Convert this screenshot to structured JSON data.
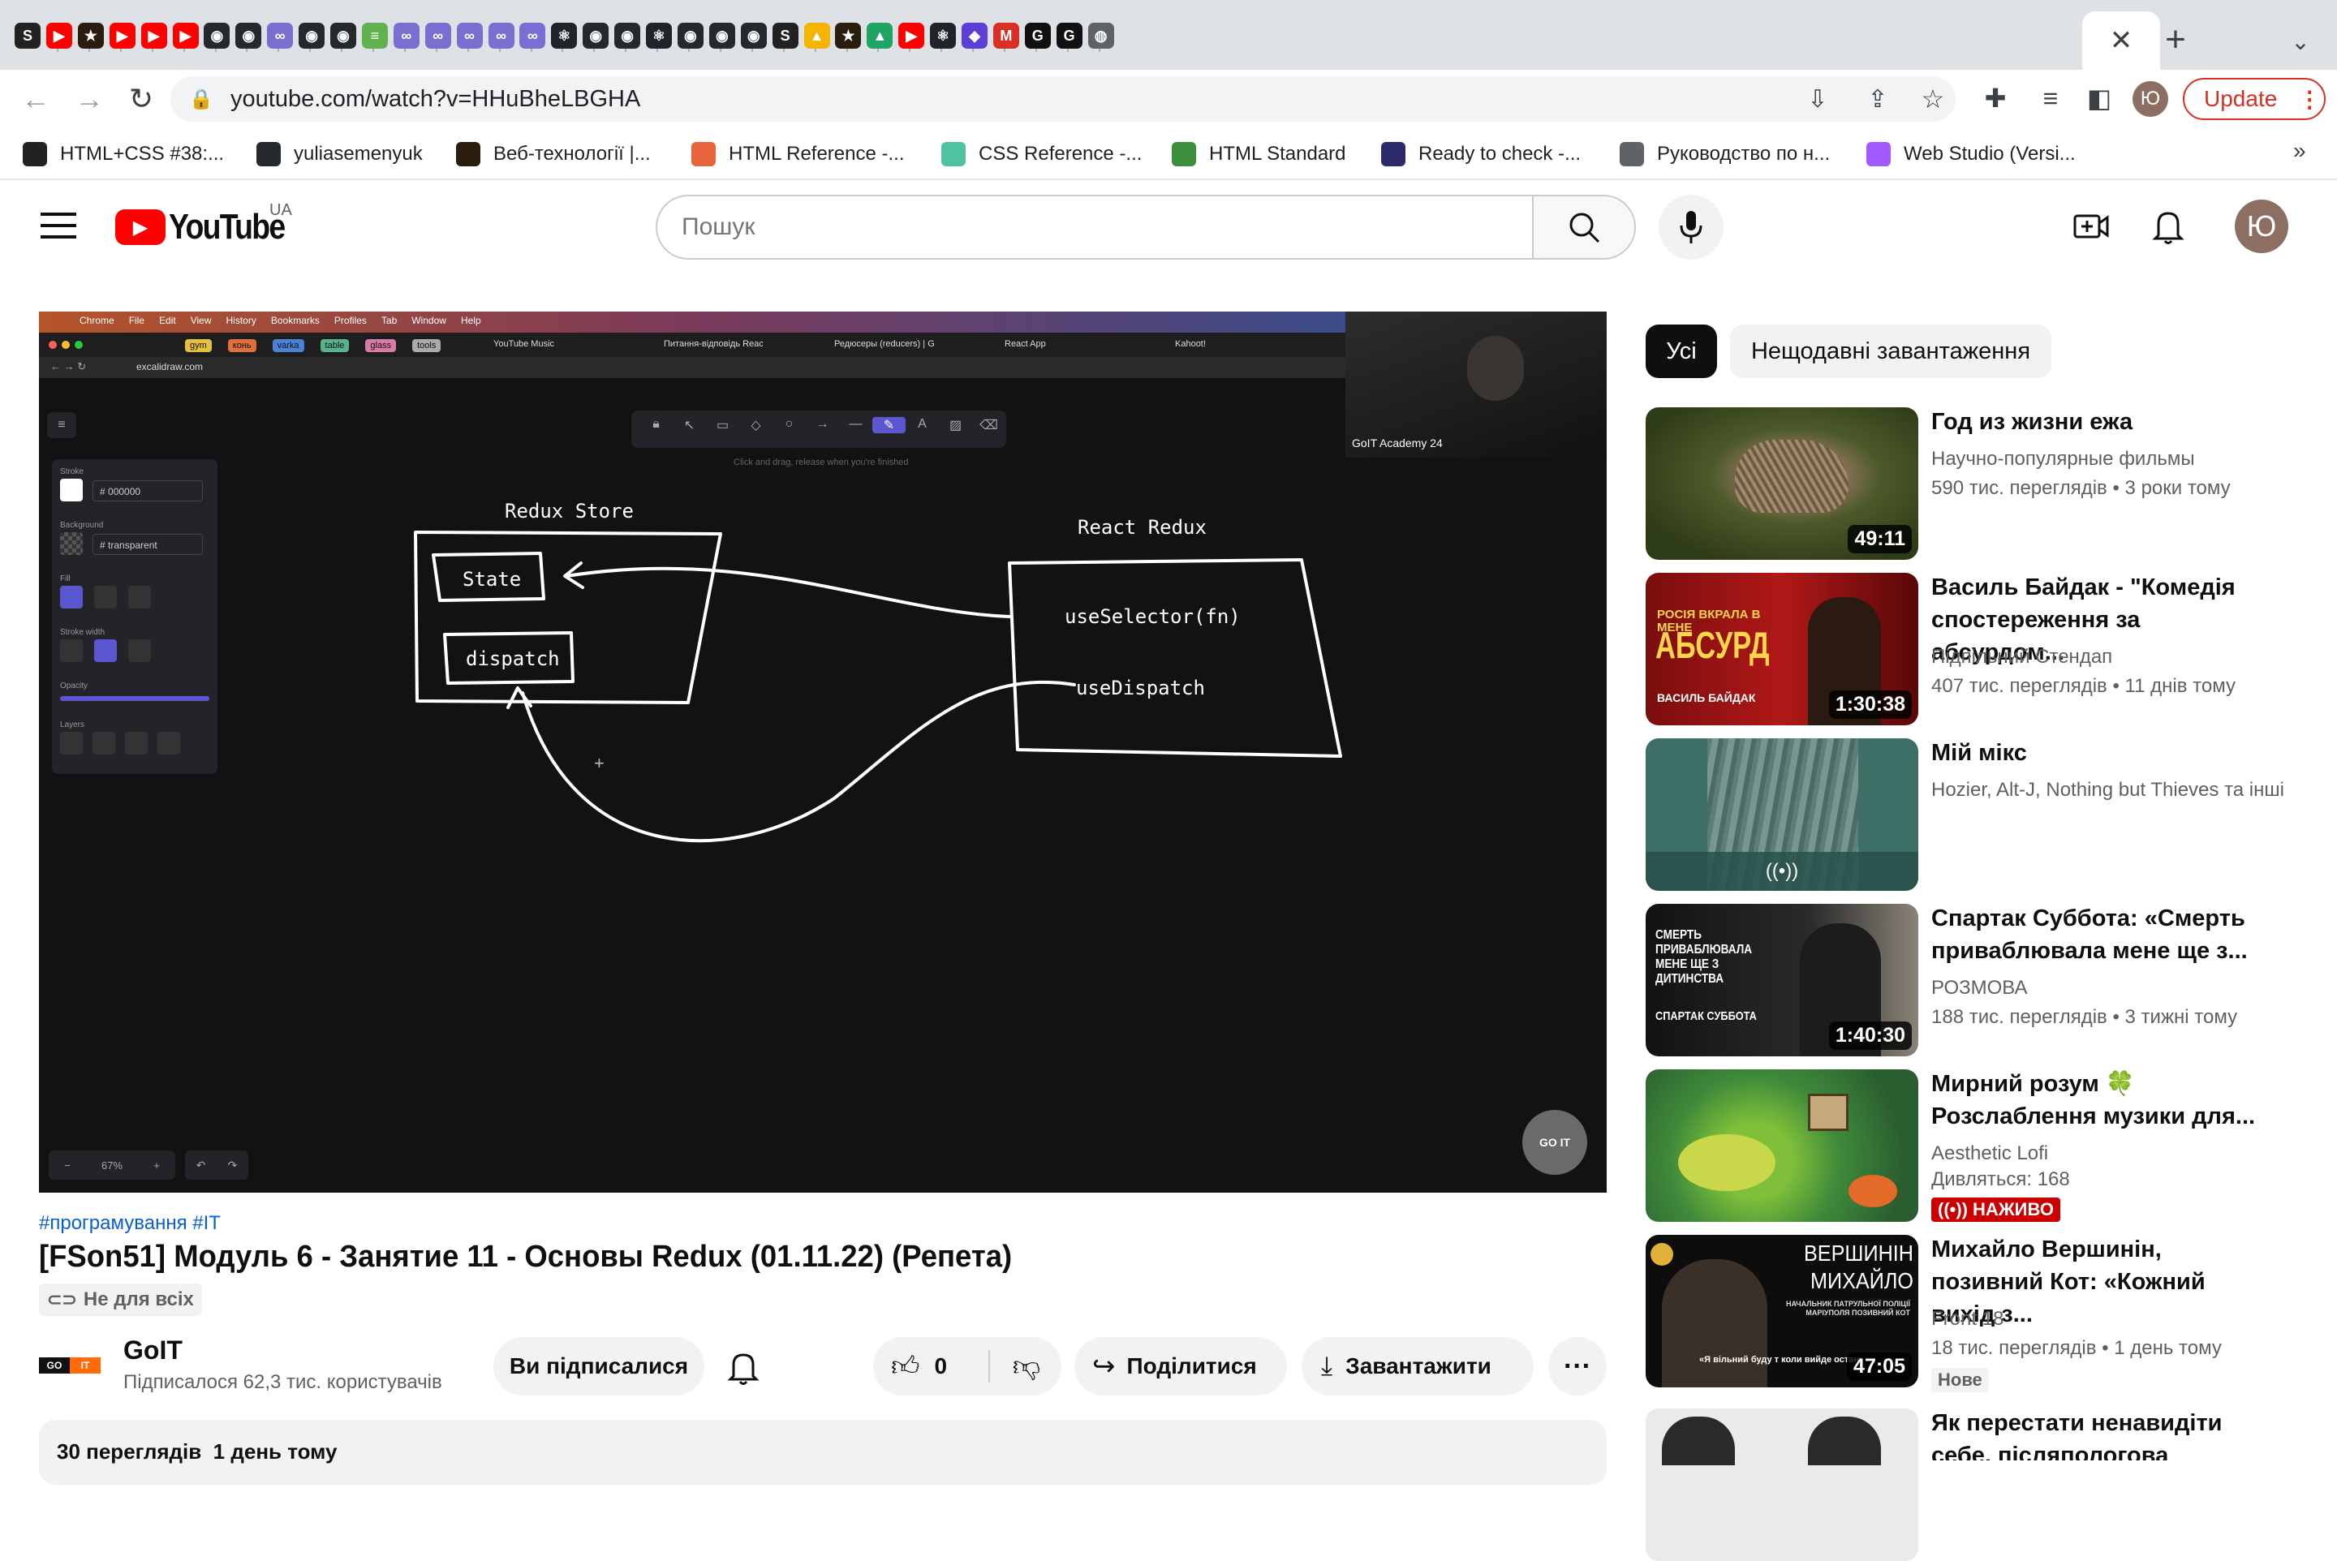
{
  "browser": {
    "tab_favicons": [
      {
        "icon": "s-circle-icon",
        "color": "#222222",
        "glyph": "S"
      },
      {
        "icon": "youtube-icon",
        "color": "#ff0000",
        "glyph": "▶"
      },
      {
        "icon": "star-icon",
        "color": "#2b1d0e",
        "glyph": "★"
      },
      {
        "icon": "youtube-icon",
        "color": "#ff0000",
        "glyph": "▶"
      },
      {
        "icon": "youtube-icon",
        "color": "#ff0000",
        "glyph": "▶"
      },
      {
        "icon": "youtube-icon",
        "color": "#ff0000",
        "glyph": "▶"
      },
      {
        "icon": "github-icon",
        "color": "#24292e",
        "glyph": "◉"
      },
      {
        "icon": "github-icon",
        "color": "#24292e",
        "glyph": "◉"
      },
      {
        "icon": "knot-icon",
        "color": "#7a6fd0",
        "glyph": "∞"
      },
      {
        "icon": "github-icon",
        "color": "#24292e",
        "glyph": "◉"
      },
      {
        "icon": "github-icon",
        "color": "#24292e",
        "glyph": "◉"
      },
      {
        "icon": "notes-icon",
        "color": "#62b24f",
        "glyph": "≡"
      },
      {
        "icon": "knot-icon",
        "color": "#7a6fd0",
        "glyph": "∞"
      },
      {
        "icon": "knot-icon",
        "color": "#7a6fd0",
        "glyph": "∞"
      },
      {
        "icon": "knot-icon",
        "color": "#7a6fd0",
        "glyph": "∞"
      },
      {
        "icon": "knot-icon",
        "color": "#7a6fd0",
        "glyph": "∞"
      },
      {
        "icon": "knot-icon",
        "color": "#7a6fd0",
        "glyph": "∞"
      },
      {
        "icon": "react-icon",
        "color": "#20232a",
        "glyph": "⚛"
      },
      {
        "icon": "github-icon",
        "color": "#24292e",
        "glyph": "◉"
      },
      {
        "icon": "github-icon",
        "color": "#24292e",
        "glyph": "◉"
      },
      {
        "icon": "react-icon",
        "color": "#20232a",
        "glyph": "⚛"
      },
      {
        "icon": "github-icon",
        "color": "#24292e",
        "glyph": "◉"
      },
      {
        "icon": "github-icon",
        "color": "#24292e",
        "glyph": "◉"
      },
      {
        "icon": "github-icon",
        "color": "#24292e",
        "glyph": "◉"
      },
      {
        "icon": "s-circle-icon",
        "color": "#222222",
        "glyph": "S"
      },
      {
        "icon": "drive-icon",
        "color": "#f4b400",
        "glyph": "▲"
      },
      {
        "icon": "star-icon",
        "color": "#2b1d0e",
        "glyph": "★"
      },
      {
        "icon": "drive-icon",
        "color": "#1fa463",
        "glyph": "▲"
      },
      {
        "icon": "youtube-icon",
        "color": "#ff0000",
        "glyph": "▶"
      },
      {
        "icon": "react-icon",
        "color": "#20232a",
        "glyph": "⚛"
      },
      {
        "icon": "prisma-icon",
        "color": "#5b3fd6",
        "glyph": "◆"
      },
      {
        "icon": "gmail-icon",
        "color": "#d93025",
        "glyph": "M"
      },
      {
        "icon": "goit-icon",
        "color": "#111111",
        "glyph": "G"
      },
      {
        "icon": "goit-icon",
        "color": "#111111",
        "glyph": "G"
      },
      {
        "icon": "globe-icon",
        "color": "#5f6368",
        "glyph": "◍"
      }
    ],
    "url": "youtube.com/watch?v=HHuBheLBGHA",
    "update_label": "Update",
    "profile_initial": "Ю",
    "bookmarks": [
      {
        "label": "HTML+CSS #38:...",
        "icon": "s-circle-icon",
        "color": "#222222"
      },
      {
        "label": "yuliasemenyuk",
        "icon": "github-icon",
        "color": "#24292e"
      },
      {
        "label": "Веб-технології |...",
        "icon": "star-icon",
        "color": "#2b1d0e"
      },
      {
        "label": "HTML Reference -...",
        "icon": "codecademy-icon",
        "color": "#e8643c"
      },
      {
        "label": "CSS Reference -...",
        "icon": "triangle-icon",
        "color": "#4fc3a1"
      },
      {
        "label": "HTML Standard",
        "icon": "question-icon",
        "color": "#3c8f3c"
      },
      {
        "label": "Ready to check -...",
        "icon": "logo-icon",
        "color": "#2d2a6b"
      },
      {
        "label": "Руководство по н...",
        "icon": "globe-icon",
        "color": "#5f6368"
      },
      {
        "label": "Web Studio (Versi...",
        "icon": "figma-icon",
        "color": "#a259ff"
      }
    ],
    "more_bookmarks": "»"
  },
  "youtube": {
    "logo_text": "YouTube",
    "region": "UA",
    "search_placeholder": "Пошук",
    "avatar_initial": "Ю",
    "brand_color": "#ff0000"
  },
  "video_frame": {
    "mac_menu": [
      "Chrome",
      "File",
      "Edit",
      "View",
      "History",
      "Bookmarks",
      "Profiles",
      "Tab",
      "Window",
      "Help"
    ],
    "tab_chips": [
      "gym",
      "конь",
      "varka",
      "table",
      "glass",
      "tools"
    ],
    "tabs": [
      "YouTube Music",
      "Питання-відповідь Reac",
      "Редюсеры (reducers) | G",
      "React App",
      "Kahoot!"
    ],
    "url": "excalidraw.com",
    "hint": "Click and drag, release when you're finished",
    "panel": {
      "stroke_label": "Stroke",
      "stroke_value": "000000",
      "background_label": "Background",
      "background_value": "transparent",
      "fill_label": "Fill",
      "stroke_width_label": "Stroke width",
      "opacity_label": "Opacity",
      "layers_label": "Layers"
    },
    "zoom": "67%",
    "webcam_label": "GoIT Academy 24",
    "diagram": {
      "store_title": "Redux Store",
      "state": "State",
      "dispatch": "dispatch",
      "react_title": "React Redux",
      "use_selector": "useSelector(fn)",
      "use_dispatch": "useDispatch"
    },
    "watermark": "GO IT"
  },
  "video": {
    "hashtags": "#програмування #IT",
    "title": "[FSon51] Модуль 6 - Занятие 11 - Основы Redux (01.11.22) (Репета)",
    "restriction": "Не для всіх",
    "channel_name": "GoIT",
    "subscribers": "Підписалося 62,3 тис. користувачів",
    "subscribed_label": "Ви підписалися",
    "likes": "0",
    "share_label": "Поділитися",
    "download_label": "Завантажити",
    "description_preview": "30 переглядів  1 день тому"
  },
  "filters": [
    {
      "label": "Усі",
      "active": true
    },
    {
      "label": "Нещодавні завантаження",
      "active": false
    }
  ],
  "recommendations": [
    {
      "title": "Год из жизни ежа",
      "channel": "Научно-популярные фильмы",
      "views": "590 тис. переглядів",
      "age": "3 роки тому",
      "duration": "49:11"
    },
    {
      "title": "Василь Байдак - \"Комедія спостереження за абсурдом...",
      "channel": "Підпільний Стендап",
      "views": "407 тис. переглядів",
      "age": "11 днів тому",
      "duration": "1:30:38",
      "thumb_text": "РОСІЯ ВКРАЛА В МЕНЕ",
      "thumb_big": "АБСУРД",
      "thumb_small": "ВАСИЛЬ БАЙДАК"
    },
    {
      "title": "Мій мікс",
      "channel": "Hozier, Alt-J, Nothing but Thieves та інші",
      "live_icon": "((•))"
    },
    {
      "title": "Спартак Суббота: «Смерть приваблювала мене ще з...",
      "channel": "РОЗМОВА",
      "views": "188 тис. переглядів",
      "age": "3 тижні тому",
      "duration": "1:40:30",
      "thumb_text": "СМЕРТЬ ПРИВАБЛЮВАЛА МЕНЕ ЩЕ З ДИТИНСТВА",
      "thumb_small": "СПАРТАК СУББОТА"
    },
    {
      "title": "Мирний розум 🍀 Розслаблення музики для...",
      "channel": "Aesthetic Lofi",
      "viewers": "Дивляться: 168",
      "live_badge": "НАЖИВО"
    },
    {
      "title": "Михайло Вершинін, позивний Кот: «Кожний вихід з...",
      "channel": "Front 18",
      "views": "18 тис. переглядів",
      "age": "1 день тому",
      "duration": "47:05",
      "badge": "Нове",
      "thumb_big": "ВЕРШИНІН МИХАЙЛО",
      "thumb_text": "НАЧАЛЬНИК ПАТРУЛЬНОЇ ПОЛІЦІЇ МАРІУПОЛЯ ПОЗИВНИЙ КОТ",
      "thumb_quote": "«Я вільний буду т коли вийде останній пол"
    },
    {
      "title": "Як перестати ненавидіти себе, післяпологова депресія"
    }
  ]
}
